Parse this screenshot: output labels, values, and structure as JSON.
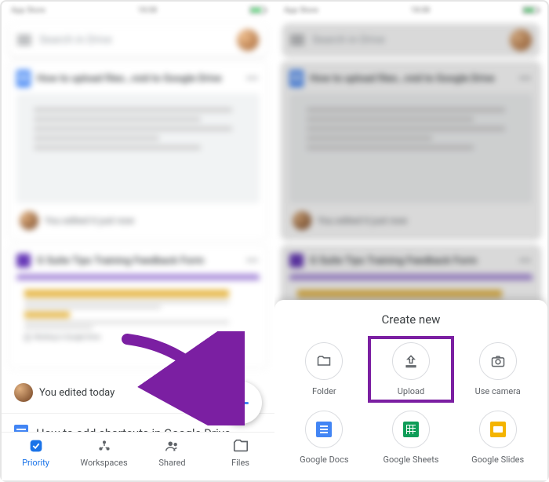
{
  "left": {
    "search_placeholder": "Search in Drive",
    "file1_title": "How to upload files…roid to Google Drive",
    "file2_title": "G Suite Tips Training Feedback Form",
    "thumb_badge": "Working in Google Drive",
    "edit1": "You edited it just now",
    "edit2": "You edited today",
    "file3_title": "How to add shortcuts in Google Drive",
    "nav": {
      "priority": "Priority",
      "workspaces": "Workspaces",
      "shared": "Shared",
      "files": "Files"
    }
  },
  "right": {
    "sheet_title": "Create new",
    "options": {
      "folder": "Folder",
      "upload": "Upload",
      "camera": "Use camera",
      "docs": "Google Docs",
      "sheets": "Google Sheets",
      "slides": "Google Slides"
    }
  }
}
